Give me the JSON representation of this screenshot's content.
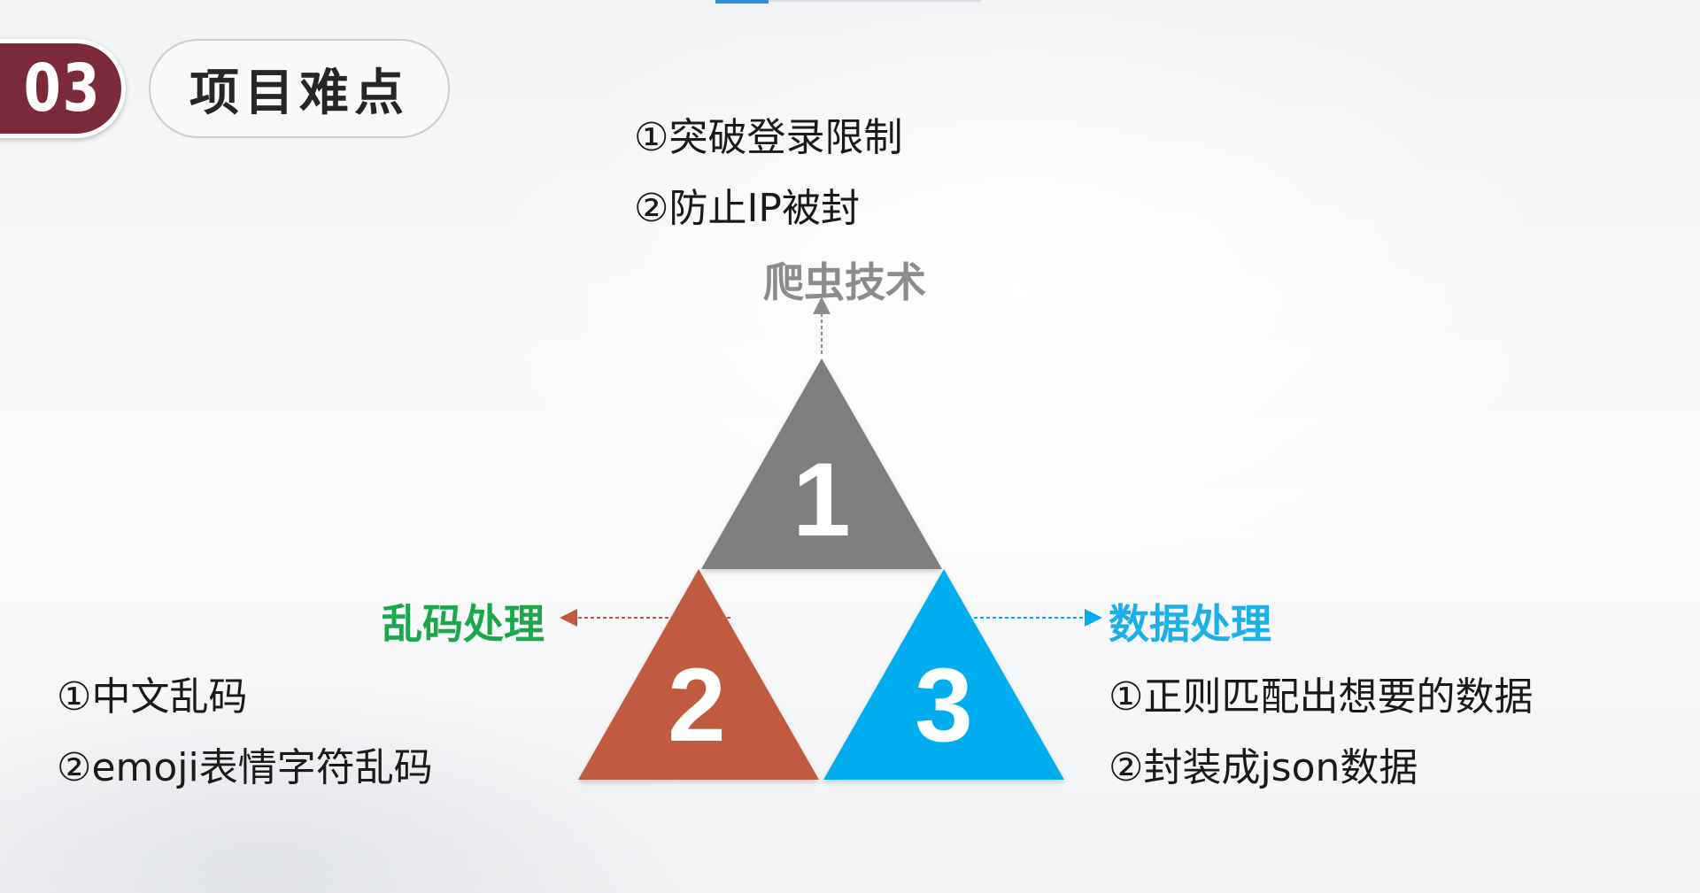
{
  "section": {
    "number": "03",
    "title": "项目难点"
  },
  "nodes": [
    {
      "number": "1",
      "heading": "爬虫技术",
      "color": "#7f7f7f",
      "heading_color": "#8c8c8c",
      "items": [
        "①突破登录限制",
        "②防止IP被封"
      ]
    },
    {
      "number": "2",
      "heading": "乱码处理",
      "color": "#c05a40",
      "heading_color": "#1aa84c",
      "items": [
        "①中文乱码",
        "②emoji表情字符乱码"
      ]
    },
    {
      "number": "3",
      "heading": "数据处理",
      "color": "#00aeef",
      "heading_color": "#1ab0e8",
      "items": [
        "①正则匹配出想要的数据",
        "②封装成json数据"
      ]
    }
  ]
}
